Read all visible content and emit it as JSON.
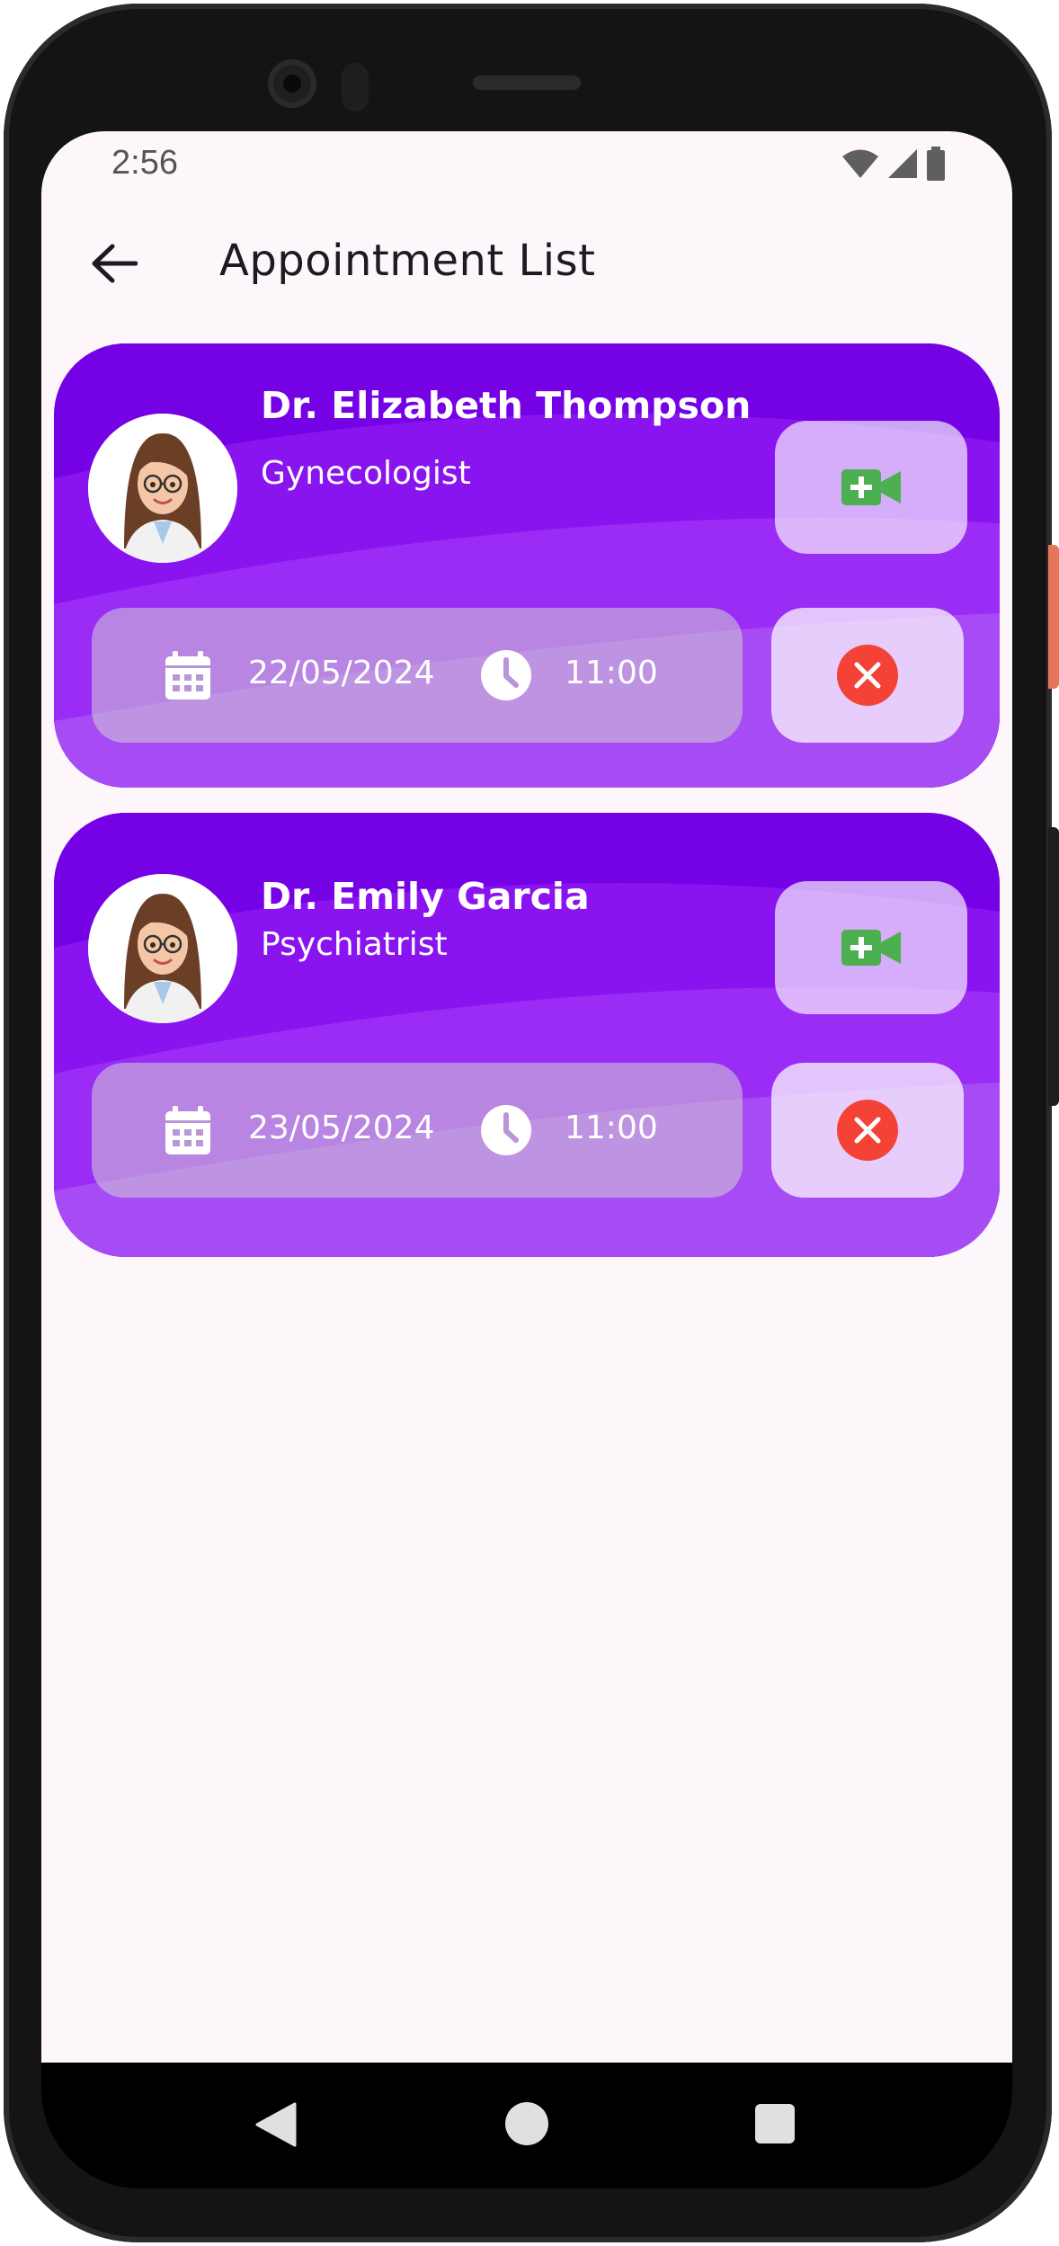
{
  "status_bar": {
    "time": "2:56"
  },
  "app_bar": {
    "title": "Appointment List",
    "back_icon": "arrow-left-icon"
  },
  "colors": {
    "card_purple": "#7402e4",
    "card_purple_light": "#a74bf5",
    "video_green": "#4caf50",
    "cancel_red": "#f44336",
    "screen_bg": "#fdf7fb"
  },
  "appointments": [
    {
      "doctor_name": "Dr. Elizabeth Thompson",
      "specialty": "Gynecologist",
      "date": "22/05/2024",
      "time": "11:00",
      "video_icon": "video-plus-icon",
      "cancel_icon": "cancel-circle-icon"
    },
    {
      "doctor_name": "Dr. Emily Garcia",
      "specialty": "Psychiatrist",
      "date": "23/05/2024",
      "time": "11:00",
      "video_icon": "video-plus-icon",
      "cancel_icon": "cancel-circle-icon"
    }
  ]
}
